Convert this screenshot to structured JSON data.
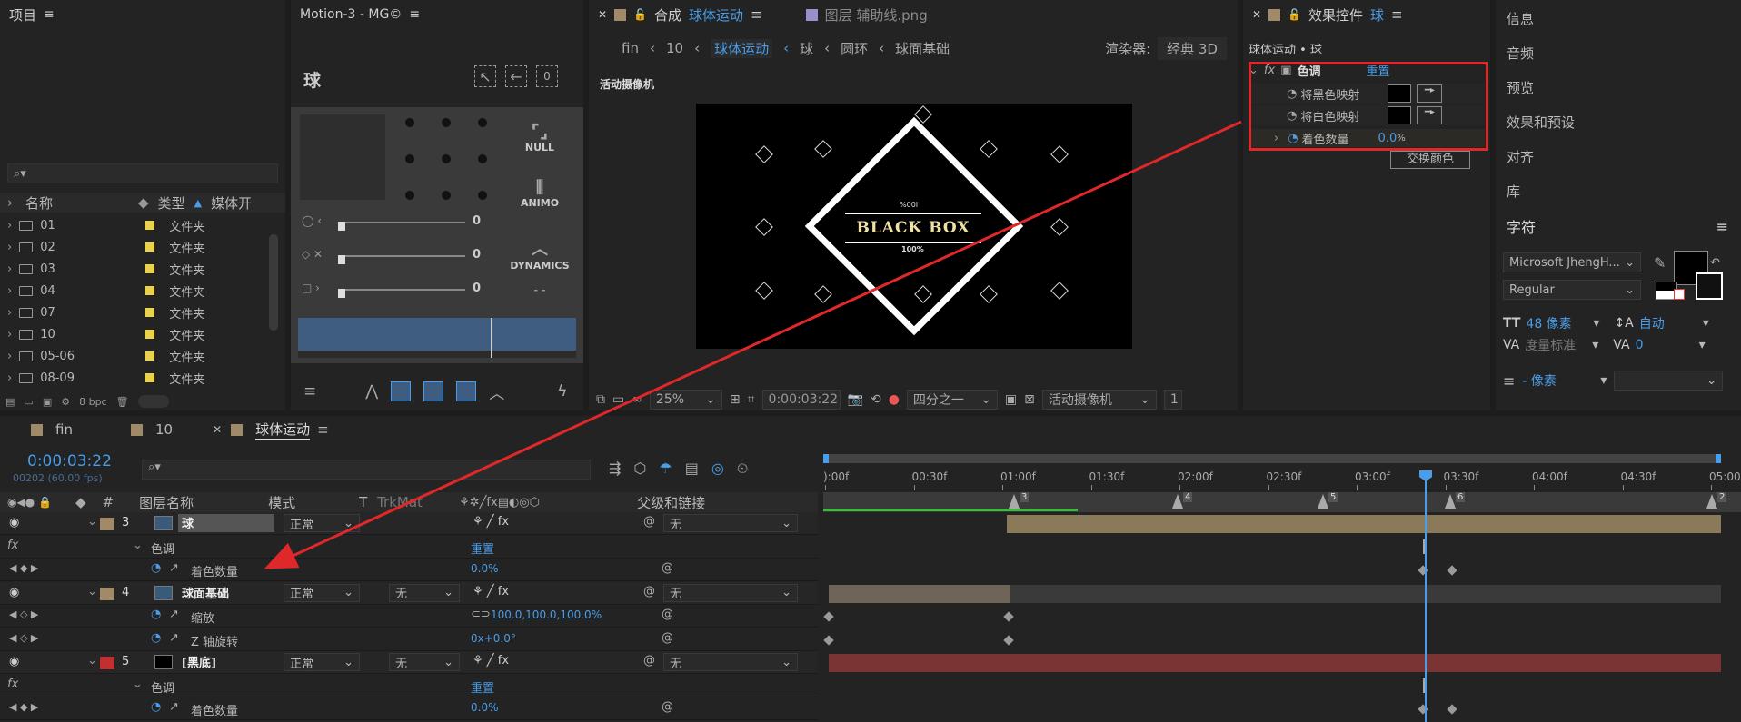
{
  "project": {
    "title": "项目",
    "columns": {
      "name": "名称",
      "type": "类型",
      "media": "媒体开"
    },
    "items": [
      {
        "name": "01",
        "type": "文件夹"
      },
      {
        "name": "02",
        "type": "文件夹"
      },
      {
        "name": "03",
        "type": "文件夹"
      },
      {
        "name": "04",
        "type": "文件夹"
      },
      {
        "name": "07",
        "type": "文件夹"
      },
      {
        "name": "10",
        "type": "文件夹"
      },
      {
        "name": "05-06",
        "type": "文件夹"
      },
      {
        "name": "08-09",
        "type": "文件夹"
      }
    ],
    "bpc": "8 bpc"
  },
  "motion": {
    "title": "Motion-3 - MG©",
    "label": "球",
    "values": [
      "0",
      "0",
      "0"
    ],
    "buttons": {
      "null": "NULL",
      "animo": "ANIMO",
      "dynamics": "DYNAMICS",
      "dashes": "- -"
    }
  },
  "comp": {
    "tab_title": "合成",
    "tab_name": "球体运动",
    "layer_tab": "图层 辅助线.png",
    "breadcrumbs": [
      "fin",
      "10",
      "球体运动",
      "球",
      "圆环",
      "球面基础"
    ],
    "renderer_label": "渲染器:",
    "renderer_value": "经典 3D",
    "camera_label": "活动摄像机",
    "viewer": {
      "logo": "BLACK BOX",
      "top_small": "%00I",
      "bottom_small": "100%"
    },
    "toolbar": {
      "zoom": "25%",
      "timecode": "0:00:03:22",
      "resolution": "四分之一",
      "view": "活动摄像机",
      "views_count": "1"
    }
  },
  "effects": {
    "title": "效果控件",
    "title_layer": "球",
    "path": "球体运动 • 球",
    "effect_name": "色调",
    "reset": "重置",
    "map_black": "将黑色映射",
    "map_white": "将白色映射",
    "amount_label": "着色数量",
    "amount_value": "0.0",
    "amount_unit": "%",
    "swap": "交换颜色"
  },
  "right_panels": {
    "items": [
      "信息",
      "音频",
      "预览",
      "效果和预设",
      "对齐",
      "库"
    ],
    "char_title": "字符",
    "font_name": "Microsoft JhengH...",
    "font_style": "Regular",
    "font_size": "48 像素",
    "leading": "自动",
    "kerning": "度量标准",
    "tracking": "0",
    "stroke_label": "- 像素"
  },
  "timeline": {
    "tabs": [
      "fin",
      "10",
      "球体运动"
    ],
    "timecode": "0:00:03:22",
    "frames_fps": "00202 (60.00 fps)",
    "cols": {
      "name": "图层名称",
      "mode": "模式",
      "t": "T",
      "trkmat": "TrkMat",
      "parent": "父级和链接"
    },
    "ruler": [
      "):00f",
      "00:30f",
      "01:00f",
      "01:30f",
      "02:00f",
      "02:30f",
      "03:00f",
      "03:30f",
      "04:00f",
      "04:30f",
      "05:00"
    ],
    "markers": [
      "3",
      "4",
      "5",
      "6",
      "2"
    ],
    "layers": [
      {
        "num": "3",
        "name": "球",
        "mode": "正常",
        "parent": "无"
      },
      {
        "num": "4",
        "name": "球面基础",
        "mode": "正常",
        "trkmat": "无",
        "parent": "无"
      },
      {
        "num": "5",
        "name": "[黑底]",
        "mode": "正常",
        "trkmat": "无",
        "parent": "无"
      }
    ],
    "tint_label": "色调",
    "reset": "重置",
    "amount_label": "着色数量",
    "amount_value": "0.0%",
    "scale_label": "缩放",
    "scale_value": "100.0,100.0,100.0%",
    "rot_label": "Z 轴旋转",
    "rot_value": "0x+0.0°",
    "fx": "fx"
  },
  "colors": {
    "accent": "#4a9de8",
    "highlight": "#e0282a",
    "bg": "#1d1d1d"
  }
}
